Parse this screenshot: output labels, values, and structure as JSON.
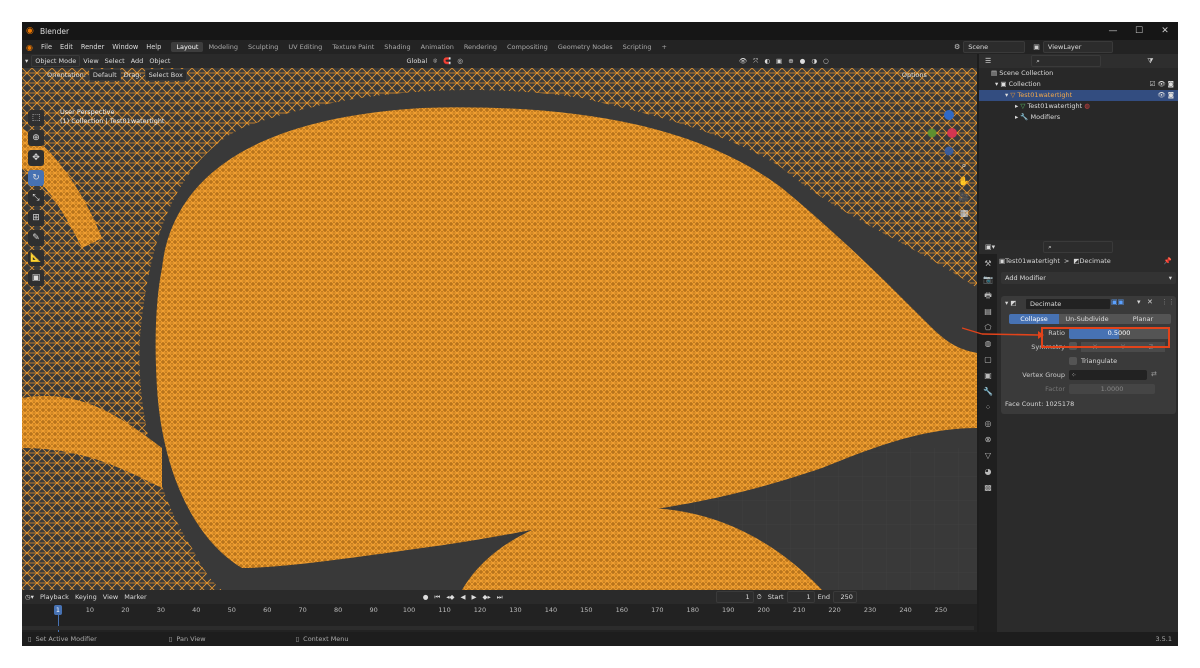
{
  "window": {
    "title": "Blender",
    "version": "3.5.1"
  },
  "menu": [
    "File",
    "Edit",
    "Render",
    "Window",
    "Help"
  ],
  "workspaces": [
    "Layout",
    "Modeling",
    "Sculpting",
    "UV Editing",
    "Texture Paint",
    "Shading",
    "Animation",
    "Rendering",
    "Compositing",
    "Geometry Nodes",
    "Scripting"
  ],
  "active_workspace": "Layout",
  "scene": {
    "scene_name": "Scene",
    "view_layer": "ViewLayer"
  },
  "viewport_header": {
    "mode": "Object Mode",
    "menus": [
      "View",
      "Select",
      "Add",
      "Object"
    ],
    "transform": "Global",
    "orientation_label": "Orientation:",
    "orientation_value": "Default",
    "drag_label": "Drag:",
    "drag_value": "Select Box",
    "options": "Options"
  },
  "viewport_info": {
    "line1": "User Perspective",
    "line2": "(1) Collection | Test01watertight"
  },
  "outliner": {
    "rows": [
      {
        "label": "Scene Collection"
      },
      {
        "label": "Collection"
      },
      {
        "label": "Test01watertight"
      },
      {
        "label": "Test01watertight"
      },
      {
        "label": "Modifiers"
      }
    ]
  },
  "properties": {
    "breadcrumb_object": "Test01watertight",
    "breadcrumb_sep": ">",
    "breadcrumb_modifier": "Decimate",
    "add_modifier": "Add Modifier",
    "modifier_name": "Decimate",
    "modes": [
      "Collapse",
      "Un-Subdivide",
      "Planar"
    ],
    "active_mode": "Collapse",
    "ratio_label": "Ratio",
    "ratio_value": "0.5000",
    "symmetry_label": "Symmetry",
    "symmetry_axes": [
      "X",
      "Y",
      "Z"
    ],
    "triangulate_label": "Triangulate",
    "vertex_group_label": "Vertex Group",
    "factor_label": "Factor",
    "factor_value": "1.0000",
    "face_count": "Face Count: 1025178"
  },
  "timeline": {
    "menus": [
      "Playback",
      "Keying",
      "View",
      "Marker"
    ],
    "current_frame": "1",
    "start_label": "Start",
    "start": "1",
    "end_label": "End",
    "end": "250",
    "ticks": [
      "1",
      "10",
      "20",
      "30",
      "40",
      "50",
      "60",
      "70",
      "80",
      "90",
      "100",
      "110",
      "120",
      "130",
      "140",
      "150",
      "160",
      "170",
      "180",
      "190",
      "200",
      "210",
      "220",
      "230",
      "240",
      "250"
    ]
  },
  "status": {
    "left": "Set Active Modifier",
    "middle": "Pan View",
    "right": "Context Menu"
  },
  "colors": {
    "accent": "#4772b3",
    "wire": "#f0a030",
    "highlight": "#e2431a",
    "bg": "#393939"
  }
}
